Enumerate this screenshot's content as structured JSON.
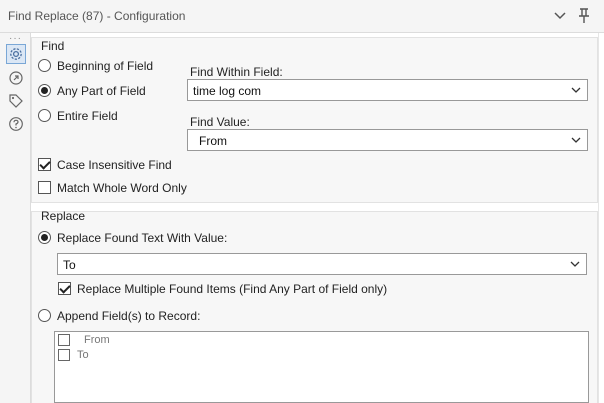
{
  "window": {
    "title": "Find Replace (87) - Configuration"
  },
  "icons": {
    "collapse": "chevron-down-icon",
    "pin": "pin-icon",
    "config": "gear-icon",
    "navigate": "navigation-icon",
    "tag": "tag-icon",
    "help": "help-icon"
  },
  "sidebar": {
    "dots": "···"
  },
  "find": {
    "legend": "Find",
    "options": [
      {
        "label": "Beginning of Field",
        "checked": false
      },
      {
        "label": "Any Part of Field",
        "checked": true
      },
      {
        "label": "Entire Field",
        "checked": false
      }
    ],
    "within_label": "Find Within Field:",
    "within_value": "time log com",
    "value_label": "Find Value:",
    "value_value": "From",
    "case_insensitive_label": "Case Insensitive Find",
    "case_insensitive_checked": true,
    "whole_word_label": "Match Whole Word Only",
    "whole_word_checked": false
  },
  "replace": {
    "legend": "Replace",
    "found_text_label": "Replace Found Text With Value:",
    "found_text_checked": true,
    "replace_value": "To",
    "multiple_label": "Replace Multiple Found Items (Find Any Part of Field only)",
    "multiple_checked": true,
    "append_label": "Append Field(s) to Record:",
    "append_checked": false,
    "fields": [
      {
        "name": "From",
        "checked": false
      },
      {
        "name": "To",
        "checked": false
      }
    ]
  },
  "colors": {
    "active_icon_bg": "#dbe7f5",
    "panel_bg": "#f7f7f7"
  }
}
